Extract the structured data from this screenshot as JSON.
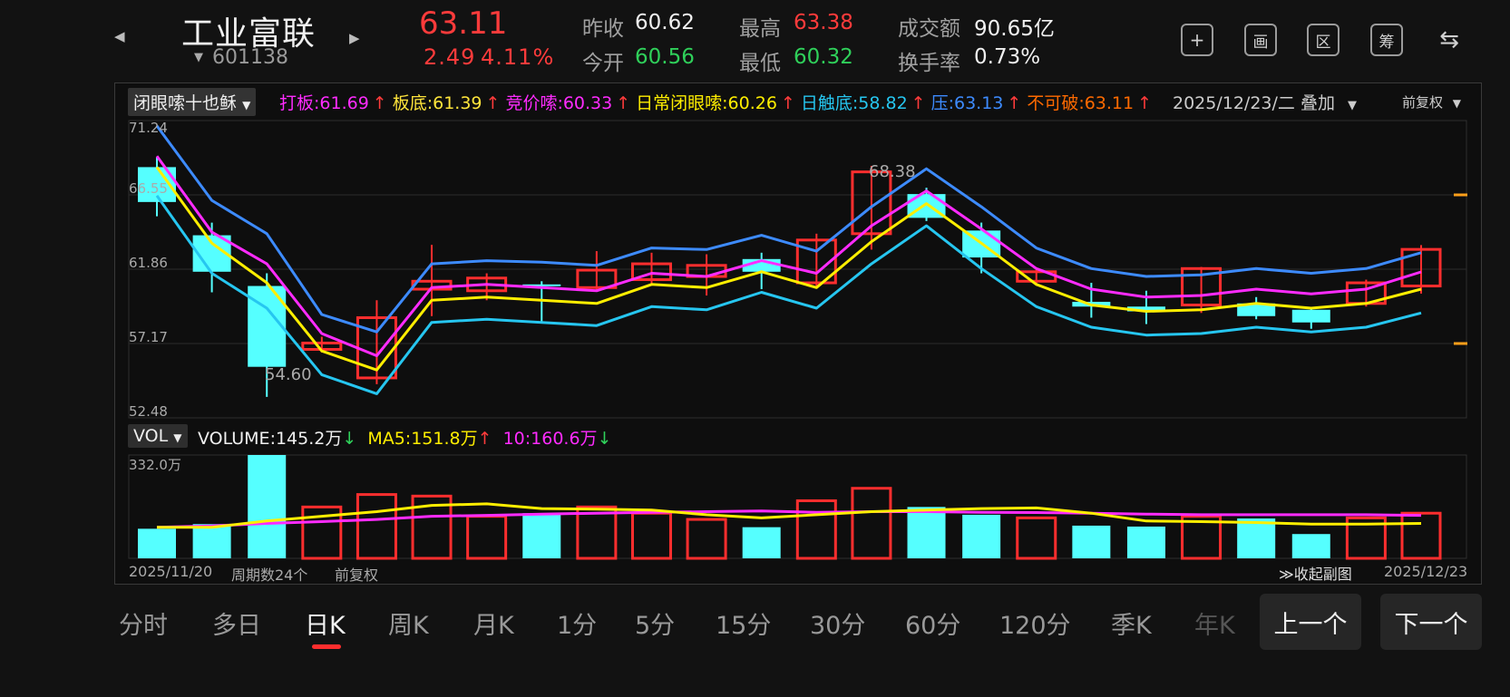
{
  "header": {
    "prev_arrow": "◀",
    "next_arrow": "▶",
    "name": "工业富联",
    "code_caret": "▼",
    "code": "601138",
    "price": "63.11",
    "change": "2.49",
    "change_pct": "4.11%",
    "quotes": {
      "prev_close_label": "昨收",
      "prev_close": "60.62",
      "open_label": "今开",
      "open": "60.56",
      "high_label": "最高",
      "high": "63.38",
      "low_label": "最低",
      "low": "60.32",
      "amount_label": "成交额",
      "amount": "90.65亿",
      "turnover_label": "换手率",
      "turnover": "0.73%"
    },
    "tools": [
      "+",
      "画",
      "区",
      "筹",
      "⇆"
    ]
  },
  "main_chart": {
    "indicator_select": "闭眼嗦十也稣",
    "indicators": [
      {
        "text": "打板:61.69",
        "color": "#ff2bff"
      },
      {
        "text": "板底:61.39",
        "color": "#ffe53b"
      },
      {
        "text": "竞价嗦:60.33",
        "color": "#ff2bff"
      },
      {
        "text": "日常闭眼嗦:60.26",
        "color": "#ffee00"
      },
      {
        "text": "日触底:58.82",
        "color": "#26c6f0"
      },
      {
        "text": "压:63.13",
        "color": "#3d8bff"
      },
      {
        "text": "不可破:63.11",
        "color": "#ff6a00"
      }
    ],
    "up_arrow": "↑",
    "date_overlay": "2025/12/23/二 叠加",
    "adjust": "前复权",
    "y_labels": [
      "71.24",
      "66.55",
      "61.86",
      "57.17",
      "52.48"
    ],
    "high_marker": "68.38",
    "low_marker": "54.60"
  },
  "volume_chart": {
    "select": "VOL",
    "volume": "VOLUME:145.2万",
    "ma5": "MA5:151.8万",
    "ma10": "10:160.6万",
    "down_arrow": "↓",
    "up_arrow": "↑",
    "y_max": "332.0万"
  },
  "footer": {
    "start_date": "2025/11/20",
    "period_count": "周期数24个",
    "adjust": "前复权",
    "collapse": "≫收起副图",
    "end_date": "2025/12/23"
  },
  "tabs": [
    "分时",
    "多日",
    "日K",
    "周K",
    "月K",
    "1分",
    "5分",
    "15分",
    "30分",
    "60分",
    "120分",
    "季K",
    "年K"
  ],
  "active_tab": "日K",
  "buttons": {
    "prev": "上一个",
    "next": "下一个"
  },
  "colors": {
    "up": "#ff2e2e",
    "down": "#55ffff",
    "blue": "#3d8bff",
    "magenta": "#ff2bff",
    "yellow": "#ffee00",
    "cyan": "#26c6f0"
  },
  "chart_data": {
    "type": "candlestick",
    "ylim": [
      52.48,
      71.24
    ],
    "candles": [
      {
        "o": 68.3,
        "h": 68.9,
        "l": 65.2,
        "c": 66.1,
        "v": 95
      },
      {
        "o": 64.0,
        "h": 64.8,
        "l": 60.4,
        "c": 61.7,
        "v": 110
      },
      {
        "o": 60.8,
        "h": 61.6,
        "l": 53.8,
        "c": 55.7,
        "v": 332
      },
      {
        "o": 56.8,
        "h": 57.6,
        "l": 56.6,
        "c": 57.2,
        "v": 165
      },
      {
        "o": 55.0,
        "h": 59.9,
        "l": 54.6,
        "c": 58.8,
        "v": 205
      },
      {
        "o": 60.6,
        "h": 63.4,
        "l": 58.9,
        "c": 61.1,
        "v": 200
      },
      {
        "o": 60.5,
        "h": 61.6,
        "l": 59.9,
        "c": 61.3,
        "v": 135
      },
      {
        "o": 60.9,
        "h": 61.1,
        "l": 58.5,
        "c": 60.8,
        "v": 145
      },
      {
        "o": 60.7,
        "h": 63.0,
        "l": 60.5,
        "c": 61.8,
        "v": 165
      },
      {
        "o": 61.2,
        "h": 62.9,
        "l": 60.9,
        "c": 62.2,
        "v": 145
      },
      {
        "o": 61.4,
        "h": 62.8,
        "l": 60.2,
        "c": 62.1,
        "v": 125
      },
      {
        "o": 62.5,
        "h": 62.9,
        "l": 60.6,
        "c": 61.7,
        "v": 100
      },
      {
        "o": 61.0,
        "h": 64.1,
        "l": 60.7,
        "c": 63.7,
        "v": 185
      },
      {
        "o": 64.1,
        "h": 68.38,
        "l": 63.1,
        "c": 68.0,
        "v": 225
      },
      {
        "o": 66.6,
        "h": 67.0,
        "l": 64.9,
        "c": 65.1,
        "v": 165
      },
      {
        "o": 64.3,
        "h": 64.8,
        "l": 61.6,
        "c": 62.6,
        "v": 140
      },
      {
        "o": 61.1,
        "h": 61.9,
        "l": 60.9,
        "c": 61.7,
        "v": 130
      },
      {
        "o": 59.8,
        "h": 61.0,
        "l": 58.8,
        "c": 59.5,
        "v": 105
      },
      {
        "o": 59.5,
        "h": 60.5,
        "l": 58.4,
        "c": 59.2,
        "v": 102
      },
      {
        "o": 59.6,
        "h": 62.0,
        "l": 59.1,
        "c": 61.9,
        "v": 135
      },
      {
        "o": 59.7,
        "h": 60.1,
        "l": 58.7,
        "c": 58.9,
        "v": 128
      },
      {
        "o": 59.3,
        "h": 59.4,
        "l": 58.1,
        "c": 58.5,
        "v": 78
      },
      {
        "o": 59.7,
        "h": 61.2,
        "l": 59.5,
        "c": 61.0,
        "v": 130
      },
      {
        "o": 60.8,
        "h": 63.38,
        "l": 60.32,
        "c": 63.11,
        "v": 145
      }
    ],
    "lines": {
      "blue": [
        70.9,
        66.2,
        64.1,
        59.0,
        57.9,
        62.2,
        62.4,
        62.3,
        62.1,
        63.2,
        63.1,
        64.0,
        63.0,
        65.8,
        68.2,
        65.8,
        63.2,
        61.9,
        61.4,
        61.5,
        61.9,
        61.6,
        61.9,
        62.9
      ],
      "magenta": [
        69.0,
        64.2,
        62.2,
        57.8,
        56.4,
        60.7,
        60.9,
        60.7,
        60.5,
        61.6,
        61.4,
        62.4,
        61.6,
        64.6,
        66.8,
        64.4,
        61.9,
        60.6,
        60.1,
        60.2,
        60.6,
        60.3,
        60.6,
        61.69
      ],
      "yellow": [
        68.3,
        63.5,
        61.0,
        56.7,
        55.5,
        59.9,
        60.1,
        59.9,
        59.7,
        60.9,
        60.7,
        61.7,
        60.7,
        63.6,
        66.0,
        63.5,
        60.9,
        59.6,
        59.2,
        59.3,
        59.7,
        59.4,
        59.7,
        60.6
      ],
      "cyan": [
        66.5,
        61.6,
        59.4,
        55.2,
        54.0,
        58.5,
        58.7,
        58.5,
        58.3,
        59.5,
        59.3,
        60.4,
        59.4,
        62.2,
        64.6,
        61.9,
        59.5,
        58.2,
        57.7,
        57.8,
        58.2,
        57.9,
        58.2,
        59.1
      ]
    },
    "vol_ylim": [
      0,
      332
    ],
    "ma5": [
      100,
      100,
      120,
      135,
      150,
      170,
      175,
      160,
      158,
      155,
      140,
      130,
      140,
      150,
      155,
      160,
      162,
      145,
      120,
      118,
      115,
      110,
      110,
      112
    ],
    "ma10": [
      100,
      104,
      112,
      118,
      125,
      135,
      138,
      142,
      145,
      148,
      150,
      152,
      148,
      150,
      150,
      148,
      147,
      145,
      142,
      140,
      140,
      140,
      140,
      138
    ],
    "right_markers": [
      66.55,
      57.17
    ]
  }
}
